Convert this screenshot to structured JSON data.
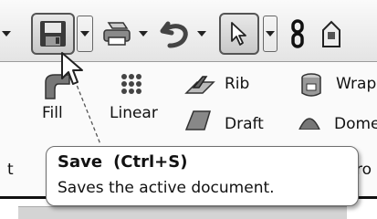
{
  "tooltip": {
    "title": "Save",
    "shortcut": "(Ctrl+S)",
    "description": "Saves the active document."
  },
  "ribbon": {
    "fillet_label": "Fill",
    "linear_label": "Linear",
    "rib_label": "Rib",
    "wrap_label": "Wrap",
    "draft_label": "Draft",
    "dome_label": "Dome",
    "left_edge_text": "t",
    "right_edge_text": "ro"
  },
  "icons": {
    "save": "save-icon",
    "print": "print-icon",
    "undo": "undo-icon",
    "select": "select-arrow-icon",
    "rebuild": "rebuild-icon",
    "options": "options-icon"
  },
  "colors": {
    "tooltip_border": "#6e6e6e",
    "toolbar_top": "#fafafa",
    "toolbar_bottom": "#e4e4e4"
  }
}
